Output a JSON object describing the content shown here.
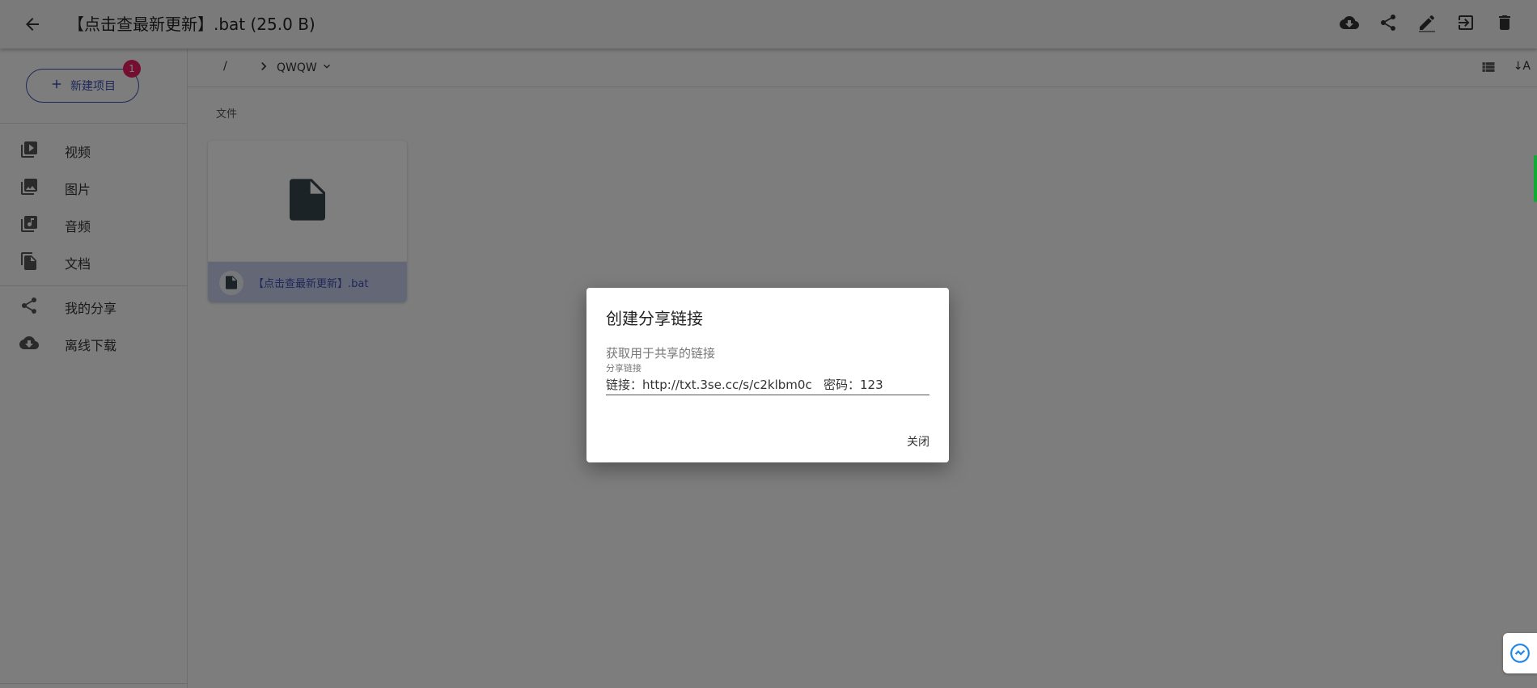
{
  "appbar": {
    "title": "【点击查最新更新】.bat (25.0 B)"
  },
  "sidebar": {
    "new_button_label": "新建项目",
    "badge_count": "1",
    "items": [
      {
        "label": "视频",
        "icon": "video-library-icon"
      },
      {
        "label": "图片",
        "icon": "photo-library-icon"
      },
      {
        "label": "音频",
        "icon": "library-music-icon"
      },
      {
        "label": "文档",
        "icon": "file-copy-icon"
      },
      {
        "label": "我的分享",
        "icon": "share-icon"
      },
      {
        "label": "离线下载",
        "icon": "cloud-download-icon"
      }
    ]
  },
  "breadcrumb": {
    "root": "/",
    "folder": "QWQW",
    "sort_label": "A"
  },
  "main": {
    "section_title": "文件",
    "file": {
      "name": "【点击查最新更新】.bat"
    }
  },
  "dialog": {
    "title": "创建分享链接",
    "description": "获取用于共享的链接",
    "field_label": "分享链接",
    "field_value": "链接：http://txt.3se.cc/s/c2klbm0c   密码：123",
    "close_label": "关闭"
  },
  "colors": {
    "primary": "#3f51b5",
    "badge": "#e91e63",
    "file_icon": "#37474f"
  }
}
